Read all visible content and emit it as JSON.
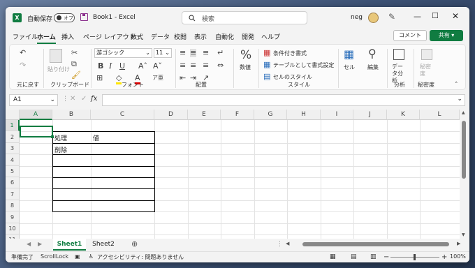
{
  "window": {
    "autosave_label": "自動保存",
    "autosave_state": "オフ",
    "title": "Book1 - Excel",
    "search_placeholder": "検索",
    "user": "neg"
  },
  "tabs": [
    "ファイル",
    "ホーム",
    "挿入",
    "ページ レイアウト",
    "数式",
    "データ",
    "校閲",
    "表示",
    "自動化",
    "開発",
    "ヘルプ"
  ],
  "comment_btn": "コメント",
  "share_btn": "共有",
  "ribbon": {
    "undo_label": "元に戻す",
    "clipboard_label": "クリップボード",
    "paste_label": "貼り付け",
    "font_label": "フォント",
    "font_name": "游ゴシック",
    "font_size": "11",
    "align_label": "配置",
    "number_label": "数値",
    "style_label": "スタイル",
    "cond_format": "条件付き書式",
    "table_format": "テーブルとして書式設定",
    "cell_style": "セルのスタイル",
    "cells_label": "セル",
    "edit_label": "編集",
    "data_analysis": "データ分析",
    "analysis_label": "分析",
    "sensitivity": "秘密度",
    "sensitivity_label": "秘密度"
  },
  "formula_bar": {
    "name_box": "A1",
    "fx": "fx"
  },
  "grid": {
    "columns": [
      "A",
      "B",
      "C",
      "D",
      "E",
      "F",
      "G",
      "H",
      "I",
      "J",
      "K",
      "L"
    ],
    "rows": [
      "1",
      "2",
      "3",
      "4",
      "5",
      "6",
      "7",
      "8",
      "9",
      "10",
      "11"
    ],
    "cells": {
      "B2": "処理",
      "C2": "値",
      "B3": "削除"
    }
  },
  "sheets": [
    "Sheet1",
    "Sheet2"
  ],
  "status": {
    "ready": "準備完了",
    "scroll_lock": "ScrollLock",
    "accessibility": "アクセシビリティ: 問題ありません",
    "zoom": "100%"
  }
}
